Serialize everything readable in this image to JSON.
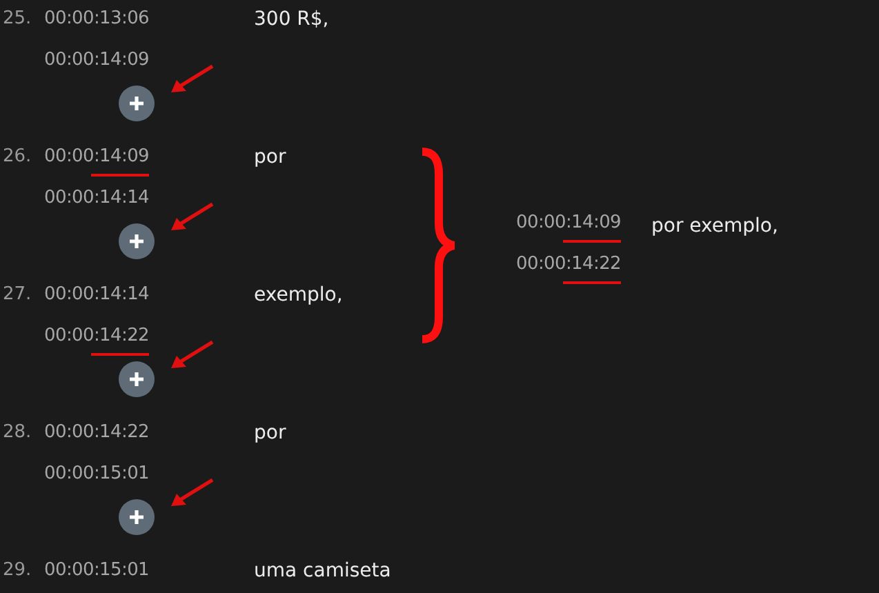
{
  "cues": [
    {
      "number": "25.",
      "start": {
        "text": "00:00:13:06",
        "underlined": false
      },
      "end": {
        "text": "00:00:14:09",
        "underlined": false
      },
      "text": "300 R$,",
      "add_button": true,
      "arrow": true
    },
    {
      "number": "26.",
      "start": {
        "text": "00:00:14:09",
        "underlined": true
      },
      "end": {
        "text": "00:00:14:14",
        "underlined": false
      },
      "text": "por",
      "add_button": true,
      "arrow": true
    },
    {
      "number": "27.",
      "start": {
        "text": "00:00:14:14",
        "underlined": false
      },
      "end": {
        "text": "00:00:14:22",
        "underlined": true
      },
      "text": "exemplo,",
      "add_button": true,
      "arrow": true
    },
    {
      "number": "28.",
      "start": {
        "text": "00:00:14:22",
        "underlined": false
      },
      "end": {
        "text": "00:00:15:01",
        "underlined": false
      },
      "text": "por",
      "add_button": true,
      "arrow": true
    },
    {
      "number": "29.",
      "start": {
        "text": "00:00:15:01",
        "underlined": false
      },
      "text": "uma camiseta"
    }
  ],
  "merged": {
    "brace": true,
    "start": {
      "text": "00:00:14:09",
      "underlined": true
    },
    "end": {
      "text": "00:00:14:22",
      "underlined": true
    },
    "text": "por exemplo,"
  }
}
